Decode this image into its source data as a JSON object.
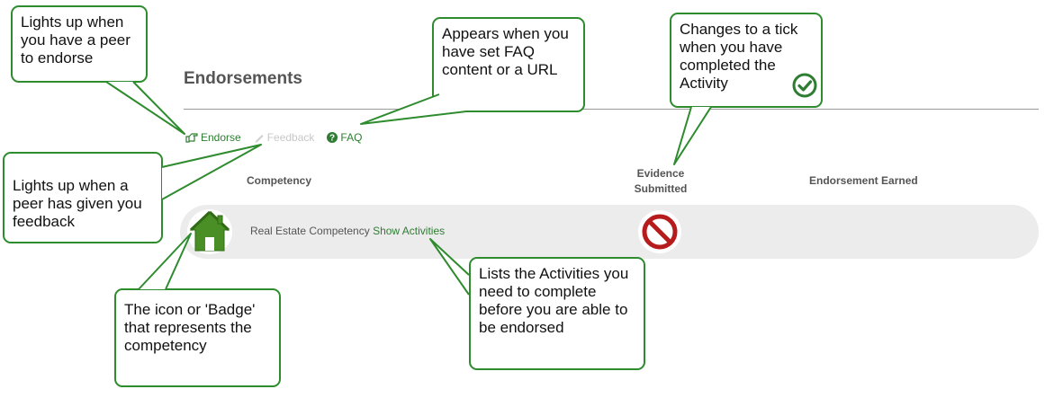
{
  "page": {
    "title": "Endorsements"
  },
  "actions": {
    "endorse_label": "Endorse",
    "feedback_label": "Feedback",
    "faq_label": "FAQ",
    "faq_icon_glyph": "?"
  },
  "table": {
    "headers": {
      "competency": "Competency",
      "evidence": "Evidence Submitted",
      "earned": "Endorsement Earned"
    },
    "rows": [
      {
        "badge_icon": "house-icon",
        "name": "Real Estate Competency",
        "link_label": "Show Activities",
        "evidence_status_icon": "no-entry-icon"
      }
    ]
  },
  "callouts": {
    "endorse": "Lights up when you have a peer to endorse",
    "faq": "Appears when you have set FAQ content or a URL",
    "evidence": "Changes to a tick when you have completed the Activity",
    "feedback": "Lights up when a peer has given you feedback",
    "badge": "The icon or 'Badge' that represents the competency",
    "activities": "Lists the Activities you need to complete before you are able to be endorsed"
  },
  "colors": {
    "accent_green": "#2e7d32",
    "callout_border": "#2e8b2e",
    "row_background": "#ececec",
    "badge_green": "#4a8f25",
    "status_red": "#b71c1c"
  }
}
